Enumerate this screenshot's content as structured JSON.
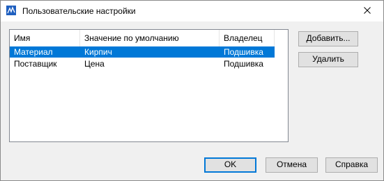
{
  "window": {
    "title": "Пользовательские настройки",
    "app_icon": "app-icon",
    "close_icon": "close-icon"
  },
  "list": {
    "columns": [
      "Имя",
      "Значение по умолчанию",
      "Владелец"
    ],
    "rows": [
      {
        "cells": [
          "Материал",
          "Кирпич",
          "Подшивка"
        ],
        "selected": true
      },
      {
        "cells": [
          "Поставщик",
          "Цена",
          "Подшивка"
        ],
        "selected": false
      }
    ]
  },
  "side_buttons": {
    "add_label": "Добавить...",
    "delete_label": "Удалить"
  },
  "footer_buttons": {
    "ok_label": "OK",
    "cancel_label": "Отмена",
    "help_label": "Справка"
  },
  "colors": {
    "selection": "#0078d7",
    "accent": "#0078d7"
  }
}
